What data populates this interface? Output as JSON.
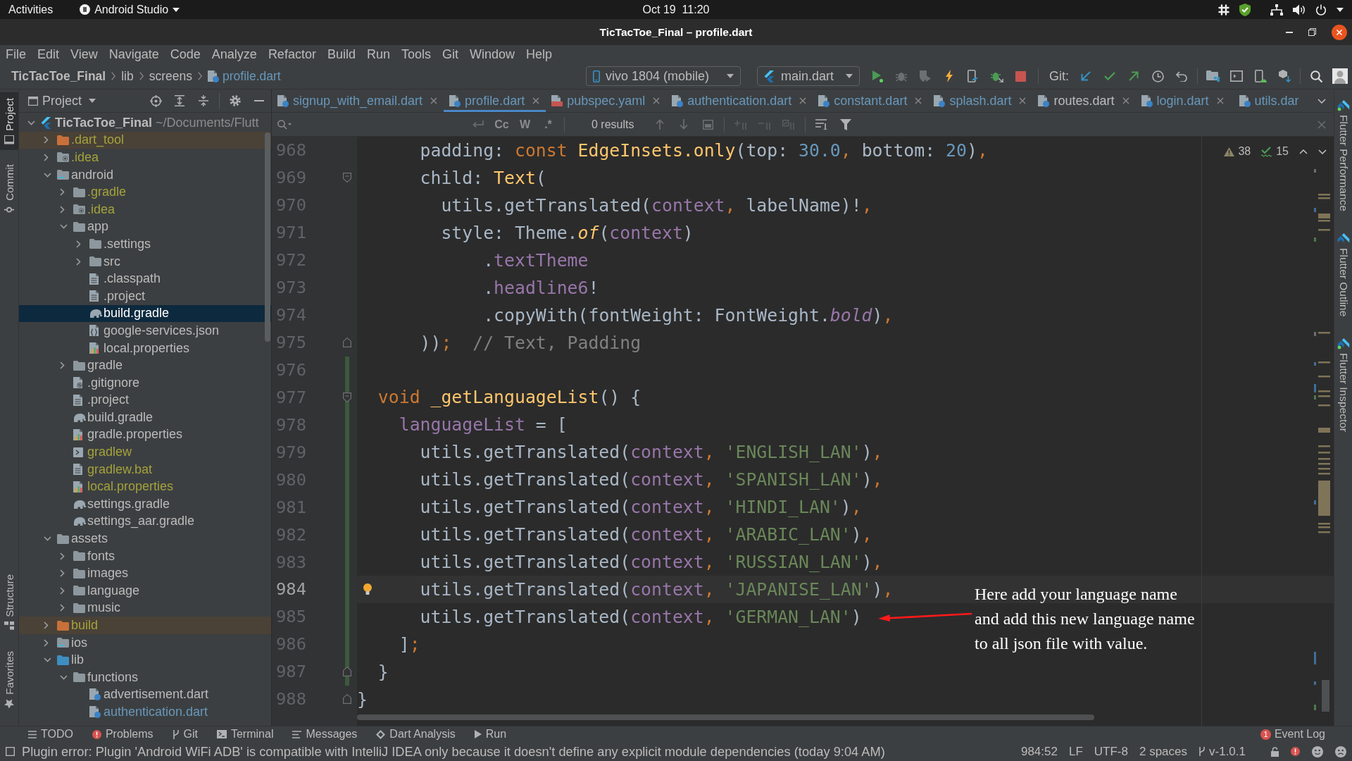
{
  "top_bar": {
    "activities": "Activities",
    "app_menu": "Android Studio",
    "clock": "Oct 19  11:20"
  },
  "window": {
    "title": "TicTacToe_Final – profile.dart"
  },
  "menu": [
    "File",
    "Edit",
    "View",
    "Navigate",
    "Code",
    "Analyze",
    "Refactor",
    "Build",
    "Run",
    "Tools",
    "Git",
    "Window",
    "Help"
  ],
  "breadcrumb": [
    {
      "label": "TicTacToe_Final",
      "kind": "project"
    },
    {
      "label": "lib",
      "kind": "folder"
    },
    {
      "label": "screens",
      "kind": "folder"
    },
    {
      "label": "profile.dart",
      "kind": "file"
    }
  ],
  "toolbar": {
    "device": "vivo 1804 (mobile)",
    "run_config": "main.dart",
    "vcs_label": "Git:"
  },
  "left_strip": [
    {
      "label": "Project",
      "selected": true
    },
    {
      "label": "Commit",
      "selected": false
    },
    {
      "label": "Structure",
      "selected": false
    },
    {
      "label": "Favorites",
      "selected": false
    }
  ],
  "project_panel": {
    "title": "Project",
    "tree": [
      {
        "name": "TicTacToe_Final",
        "path": "~/Documents/Flutt",
        "kind": "project",
        "expanded": true,
        "selected": false,
        "children": [
          {
            "name": ".dart_tool",
            "kind": "excluded-folder",
            "color": "#a4a23c",
            "expanded": false,
            "selected": false
          },
          {
            "name": ".idea",
            "kind": "settings-folder",
            "color": "#a4a23c",
            "expanded": false,
            "selected": false
          },
          {
            "name": "android",
            "kind": "module-folder",
            "expanded": true,
            "selected": false,
            "children": [
              {
                "name": ".gradle",
                "kind": "folder",
                "color": "#a4a23c",
                "expanded": false,
                "selected": false
              },
              {
                "name": ".idea",
                "kind": "settings-folder",
                "color": "#a4a23c",
                "expanded": false,
                "selected": false
              },
              {
                "name": "app",
                "kind": "folder",
                "expanded": true,
                "selected": false,
                "children": [
                  {
                    "name": ".settings",
                    "kind": "folder",
                    "expanded": false,
                    "selected": false
                  },
                  {
                    "name": "src",
                    "kind": "folder",
                    "expanded": false,
                    "selected": false
                  },
                  {
                    "name": ".classpath",
                    "kind": "file",
                    "selected": false
                  },
                  {
                    "name": ".project",
                    "kind": "file",
                    "selected": false
                  },
                  {
                    "name": "build.gradle",
                    "kind": "gradle",
                    "selected": true
                  },
                  {
                    "name": "google-services.json",
                    "kind": "json",
                    "selected": false
                  },
                  {
                    "name": "local.properties",
                    "kind": "properties",
                    "selected": false
                  }
                ]
              },
              {
                "name": "gradle",
                "kind": "folder",
                "expanded": false,
                "selected": false
              },
              {
                "name": ".gitignore",
                "kind": "ignore-file",
                "selected": false
              },
              {
                "name": ".project",
                "kind": "file",
                "selected": false
              },
              {
                "name": "build.gradle",
                "kind": "gradle",
                "selected": false
              },
              {
                "name": "gradle.properties",
                "kind": "properties",
                "selected": false
              },
              {
                "name": "gradlew",
                "kind": "script",
                "color": "#a4a23c",
                "selected": false
              },
              {
                "name": "gradlew.bat",
                "kind": "file",
                "color": "#a4a23c",
                "selected": false
              },
              {
                "name": "local.properties",
                "kind": "properties",
                "color": "#a4a23c",
                "selected": false
              },
              {
                "name": "settings.gradle",
                "kind": "gradle",
                "selected": false
              },
              {
                "name": "settings_aar.gradle",
                "kind": "gradle",
                "selected": false
              }
            ]
          },
          {
            "name": "assets",
            "kind": "folder",
            "expanded": true,
            "selected": false,
            "children": [
              {
                "name": "fonts",
                "kind": "folder",
                "expanded": false,
                "selected": false
              },
              {
                "name": "images",
                "kind": "folder",
                "expanded": false,
                "selected": false
              },
              {
                "name": "language",
                "kind": "folder",
                "expanded": false,
                "selected": false
              },
              {
                "name": "music",
                "kind": "folder",
                "expanded": false,
                "selected": false
              }
            ]
          },
          {
            "name": "build",
            "kind": "excluded-folder",
            "color": "#a4a23c",
            "expanded": false,
            "selected": false
          },
          {
            "name": "ios",
            "kind": "module-folder",
            "expanded": false,
            "selected": false
          },
          {
            "name": "lib",
            "kind": "source-folder",
            "expanded": true,
            "selected": false,
            "children": [
              {
                "name": "functions",
                "kind": "folder",
                "expanded": true,
                "selected": false,
                "children": [
                  {
                    "name": "advertisement.dart",
                    "kind": "dart",
                    "selected": false
                  },
                  {
                    "name": "authentication.dart",
                    "kind": "dart",
                    "color": "#6897bb",
                    "selected": false
                  }
                ]
              }
            ]
          }
        ]
      }
    ]
  },
  "editor": {
    "tabs": [
      {
        "label": "signup_with_email.dart",
        "kind": "dart",
        "modified": true,
        "selected": false,
        "close_button": true
      },
      {
        "label": "profile.dart",
        "kind": "dart",
        "modified": true,
        "selected": true,
        "close_button": true
      },
      {
        "label": "pubspec.yaml",
        "kind": "yaml",
        "modified": true,
        "selected": false,
        "close_button": true
      },
      {
        "label": "authentication.dart",
        "kind": "dart",
        "modified": true,
        "selected": false,
        "close_button": true
      },
      {
        "label": "constant.dart",
        "kind": "dart",
        "modified": true,
        "selected": false,
        "close_button": true
      },
      {
        "label": "splash.dart",
        "kind": "dart",
        "modified": true,
        "selected": false,
        "close_button": true
      },
      {
        "label": "routes.dart",
        "kind": "dart",
        "modified": false,
        "selected": false,
        "close_button": true
      },
      {
        "label": "login.dart",
        "kind": "dart",
        "modified": true,
        "selected": false,
        "close_button": true
      },
      {
        "label": "utils.dar",
        "kind": "dart",
        "modified": true,
        "selected": false,
        "close_button": false
      }
    ],
    "find": {
      "options": [
        {
          "label": "Cc",
          "selected": false
        },
        {
          "label": "W",
          "selected": false
        },
        {
          "label": ".*",
          "selected": false
        }
      ],
      "results": "0 results"
    },
    "lines": [
      {
        "number": "968",
        "kind": "code",
        "current": false,
        "changed": false,
        "intention": false,
        "tokens": [
          {
            "kind": "plain",
            "text": "      padding: "
          },
          {
            "kind": "keyword",
            "text": "const "
          },
          {
            "kind": "call",
            "text": "EdgeInsets.only"
          },
          {
            "kind": "plain",
            "text": "(top: "
          },
          {
            "kind": "number",
            "text": "30.0"
          },
          {
            "kind": "punct",
            "text": ","
          },
          {
            "kind": "plain",
            "text": " bottom: "
          },
          {
            "kind": "number",
            "text": "20"
          },
          {
            "kind": "plain",
            "text": ")"
          },
          {
            "kind": "punct",
            "text": ","
          }
        ]
      },
      {
        "number": "969",
        "kind": "fold-start",
        "current": false,
        "changed": false,
        "intention": false,
        "tokens": [
          {
            "kind": "plain",
            "text": "      child: "
          },
          {
            "kind": "call",
            "text": "Text"
          },
          {
            "kind": "plain",
            "text": "("
          }
        ]
      },
      {
        "number": "970",
        "kind": "code",
        "current": false,
        "changed": false,
        "intention": false,
        "tokens": [
          {
            "kind": "plain",
            "text": "        utils.getTranslated("
          },
          {
            "kind": "field",
            "text": "context"
          },
          {
            "kind": "punct",
            "text": ","
          },
          {
            "kind": "plain",
            "text": " labelName)!"
          },
          {
            "kind": "punct",
            "text": ","
          }
        ]
      },
      {
        "number": "971",
        "kind": "code",
        "current": false,
        "changed": false,
        "intention": false,
        "tokens": [
          {
            "kind": "plain",
            "text": "        style: Theme."
          },
          {
            "kind": "static-call",
            "text": "of"
          },
          {
            "kind": "plain",
            "text": "("
          },
          {
            "kind": "field",
            "text": "context"
          },
          {
            "kind": "plain",
            "text": ")"
          }
        ]
      },
      {
        "number": "972",
        "kind": "code",
        "current": false,
        "changed": false,
        "intention": false,
        "tokens": [
          {
            "kind": "plain",
            "text": "            ."
          },
          {
            "kind": "field",
            "text": "textTheme"
          }
        ]
      },
      {
        "number": "973",
        "kind": "code",
        "current": false,
        "changed": false,
        "intention": false,
        "tokens": [
          {
            "kind": "plain",
            "text": "            ."
          },
          {
            "kind": "field",
            "text": "headline6"
          },
          {
            "kind": "plain",
            "text": "!"
          }
        ]
      },
      {
        "number": "974",
        "kind": "code",
        "current": false,
        "changed": false,
        "intention": false,
        "tokens": [
          {
            "kind": "plain",
            "text": "            .copyWith(fontWeight: FontWeight."
          },
          {
            "kind": "constant",
            "text": "bold"
          },
          {
            "kind": "plain",
            "text": ")"
          },
          {
            "kind": "punct",
            "text": ","
          }
        ]
      },
      {
        "number": "975",
        "kind": "fold-end",
        "current": false,
        "changed": false,
        "intention": false,
        "tokens": [
          {
            "kind": "plain",
            "text": "      ))"
          },
          {
            "kind": "punct",
            "text": ";"
          },
          {
            "kind": "comment",
            "text": "  // Text, Padding"
          }
        ]
      },
      {
        "number": "976",
        "kind": "code",
        "current": false,
        "changed": true,
        "intention": false
      },
      {
        "number": "977",
        "kind": "fold-start",
        "current": false,
        "changed": true,
        "intention": false,
        "tokens": [
          {
            "kind": "keyword",
            "text": "  void "
          },
          {
            "kind": "call",
            "text": "_getLanguageList"
          },
          {
            "kind": "plain",
            "text": "() {"
          }
        ]
      },
      {
        "number": "978",
        "kind": "code",
        "current": false,
        "changed": true,
        "intention": false,
        "tokens": [
          {
            "kind": "field",
            "text": "    languageList"
          },
          {
            "kind": "plain",
            "text": " = ["
          }
        ]
      },
      {
        "number": "979",
        "kind": "code",
        "current": false,
        "changed": true,
        "intention": false,
        "tokens": [
          {
            "kind": "plain",
            "text": "      utils.getTranslated("
          },
          {
            "kind": "field",
            "text": "context"
          },
          {
            "kind": "punct",
            "text": ", "
          },
          {
            "kind": "string",
            "text": "'ENGLISH_LAN'"
          },
          {
            "kind": "plain",
            "text": ")"
          },
          {
            "kind": "punct",
            "text": ","
          }
        ]
      },
      {
        "number": "980",
        "kind": "code",
        "current": false,
        "changed": true,
        "intention": false,
        "tokens": [
          {
            "kind": "plain",
            "text": "      utils.getTranslated("
          },
          {
            "kind": "field",
            "text": "context"
          },
          {
            "kind": "punct",
            "text": ", "
          },
          {
            "kind": "string",
            "text": "'SPANISH_LAN'"
          },
          {
            "kind": "plain",
            "text": ")"
          },
          {
            "kind": "punct",
            "text": ","
          }
        ]
      },
      {
        "number": "981",
        "kind": "code",
        "current": false,
        "changed": true,
        "intention": false,
        "tokens": [
          {
            "kind": "plain",
            "text": "      utils.getTranslated("
          },
          {
            "kind": "field",
            "text": "context"
          },
          {
            "kind": "punct",
            "text": ", "
          },
          {
            "kind": "string",
            "text": "'HINDI_LAN'"
          },
          {
            "kind": "plain",
            "text": ")"
          },
          {
            "kind": "punct",
            "text": ","
          }
        ]
      },
      {
        "number": "982",
        "kind": "code",
        "current": false,
        "changed": true,
        "intention": false,
        "tokens": [
          {
            "kind": "plain",
            "text": "      utils.getTranslated("
          },
          {
            "kind": "field",
            "text": "context"
          },
          {
            "kind": "punct",
            "text": ", "
          },
          {
            "kind": "string",
            "text": "'ARABIC_LAN'"
          },
          {
            "kind": "plain",
            "text": ")"
          },
          {
            "kind": "punct",
            "text": ","
          }
        ]
      },
      {
        "number": "983",
        "kind": "code",
        "current": false,
        "changed": true,
        "intention": false,
        "tokens": [
          {
            "kind": "plain",
            "text": "      utils.getTranslated("
          },
          {
            "kind": "field",
            "text": "context"
          },
          {
            "kind": "punct",
            "text": ", "
          },
          {
            "kind": "string",
            "text": "'RUSSIAN_LAN'"
          },
          {
            "kind": "plain",
            "text": ")"
          },
          {
            "kind": "punct",
            "text": ","
          }
        ]
      },
      {
        "number": "984",
        "kind": "code",
        "current": true,
        "changed": true,
        "intention": true,
        "tokens": [
          {
            "kind": "plain",
            "text": "      utils.getTranslated("
          },
          {
            "kind": "field",
            "text": "context"
          },
          {
            "kind": "punct",
            "text": ", "
          },
          {
            "kind": "string",
            "text": "'JAPANISE_LAN'"
          },
          {
            "kind": "plain",
            "text": ")"
          },
          {
            "kind": "punct",
            "text": ","
          }
        ]
      },
      {
        "number": "985",
        "kind": "code",
        "current": false,
        "changed": true,
        "intention": false,
        "tokens": [
          {
            "kind": "plain",
            "text": "      utils.getTranslated("
          },
          {
            "kind": "field",
            "text": "context"
          },
          {
            "kind": "punct",
            "text": ", "
          },
          {
            "kind": "string",
            "text": "'GERMAN_LAN'"
          },
          {
            "kind": "plain",
            "text": ")"
          }
        ]
      },
      {
        "number": "986",
        "kind": "code",
        "current": false,
        "changed": true,
        "intention": false,
        "tokens": [
          {
            "kind": "plain",
            "text": "    ]"
          },
          {
            "kind": "punct",
            "text": ";"
          }
        ]
      },
      {
        "number": "987",
        "kind": "fold-end",
        "current": false,
        "changed": true,
        "intention": false,
        "tokens": [
          {
            "kind": "plain",
            "text": "  }"
          }
        ]
      },
      {
        "number": "988",
        "kind": "fold-end",
        "current": false,
        "changed": false,
        "intention": false,
        "tokens": [
          {
            "kind": "plain",
            "text": "}"
          }
        ]
      }
    ],
    "inspection": {
      "warnings": "38",
      "typos": "15"
    },
    "annotation": {
      "text": "Here add your language name and add this new language name to all json file with value."
    }
  },
  "right_strip": [
    {
      "label": "Flutter Performance",
      "live": true
    },
    {
      "label": "Flutter Outline",
      "live": false
    },
    {
      "label": "Flutter Inspector",
      "live": true
    }
  ],
  "tool_windows": [
    "TODO",
    "Problems",
    "Git",
    "Terminal",
    "Messages",
    "Dart Analysis",
    "Run"
  ],
  "event_log": {
    "label": "Event Log",
    "count": "1"
  },
  "status_bar": {
    "message": "Plugin error: Plugin 'Android WiFi ADB' is compatible with IntelliJ IDEA only because it doesn't define any explicit module dependencies (today 9:04 AM)",
    "position": "984:52",
    "line_separator": "LF",
    "encoding": "UTF-8",
    "indent": "2 spaces",
    "branch": "v-1.0.1"
  }
}
